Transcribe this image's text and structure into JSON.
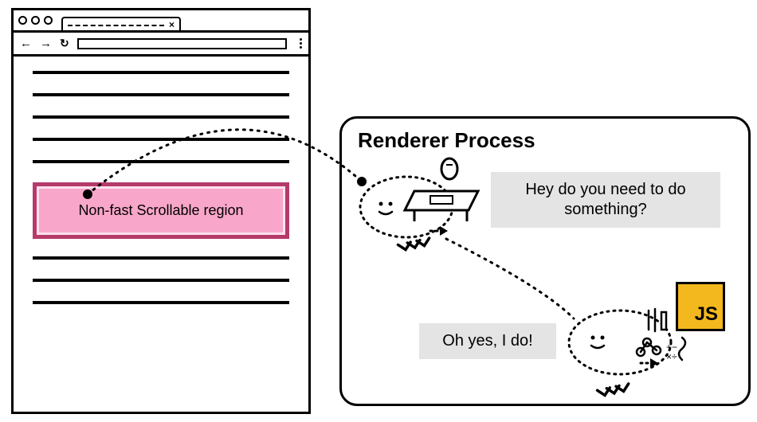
{
  "browser": {
    "region_label": "Non-fast Scrollable region"
  },
  "renderer": {
    "title": "Renderer Process",
    "bubble1": "Hey do you need to do something?",
    "bubble2": "Oh yes, I do!",
    "js_label": "JS"
  },
  "colors": {
    "region_fill": "#f8a6c9",
    "region_border": "#b53a6a",
    "bubble_bg": "#e4e4e4",
    "js_bg": "#f3b81e"
  }
}
